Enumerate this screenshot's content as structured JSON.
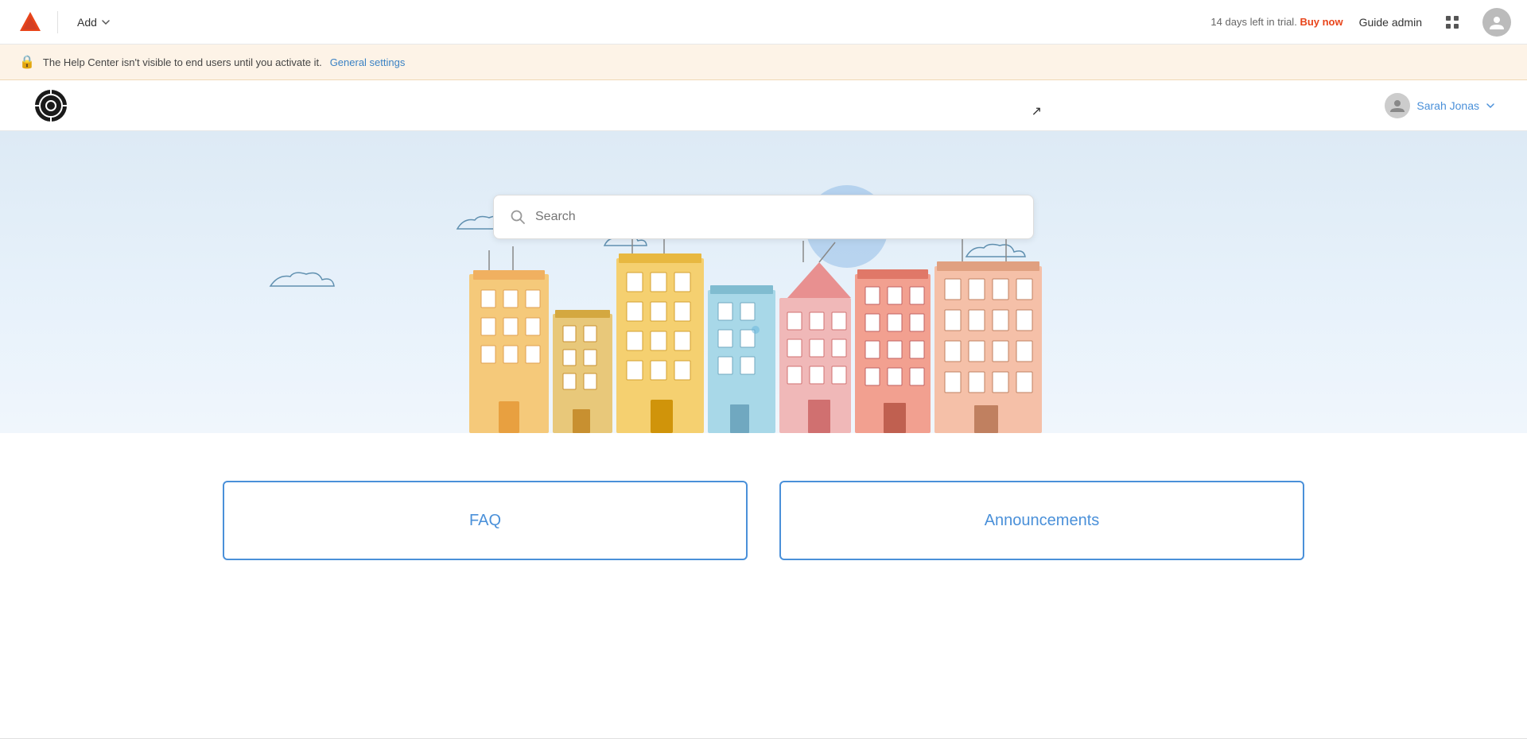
{
  "topnav": {
    "add_label": "Add",
    "trial_text": "14 days left in trial.",
    "buy_now_label": "Buy now",
    "guide_admin_label": "Guide admin"
  },
  "alert": {
    "message": "The Help Center isn't visible to end users until you activate it.",
    "link_text": "General settings"
  },
  "hcnav": {
    "user_name": "Sarah Jonas"
  },
  "hero": {
    "search_placeholder": "Search"
  },
  "cards": [
    {
      "label": "FAQ"
    },
    {
      "label": "Announcements"
    }
  ]
}
